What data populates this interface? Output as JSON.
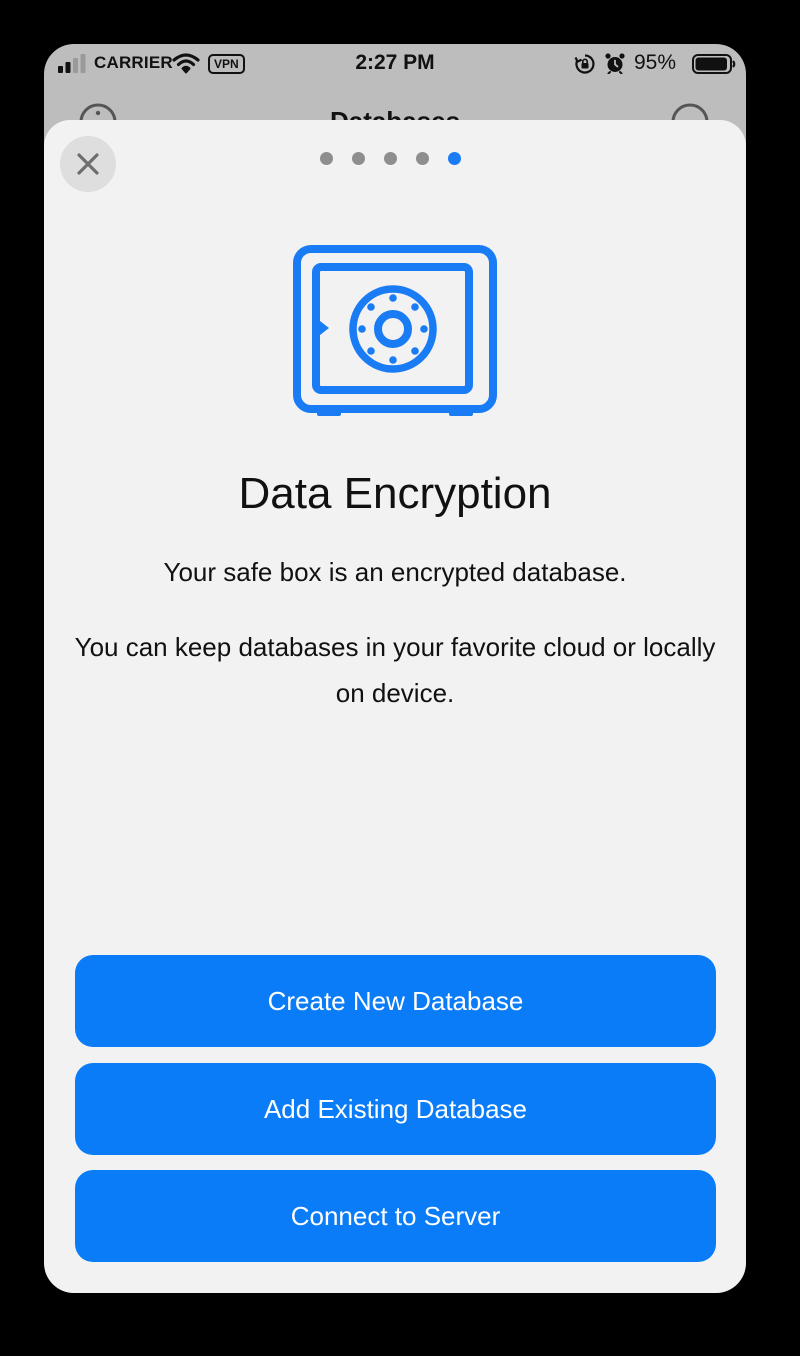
{
  "status_bar": {
    "carrier": "CARRIER",
    "vpn": "VPN",
    "time": "2:27 PM",
    "battery_percent": "95%",
    "icons": [
      "signal-icon",
      "wifi-icon",
      "rotation-lock-icon",
      "alarm-icon",
      "battery-icon"
    ]
  },
  "background_screen": {
    "title": "Databases"
  },
  "onboarding": {
    "close_icon": "close-icon",
    "page_count": 5,
    "current_page": 5,
    "illustration": "safe-box-icon",
    "heading": "Data Encryption",
    "paragraph1": "Your safe box is an encrypted database.",
    "paragraph2": "You can keep databases in your favorite cloud or locally on device."
  },
  "actions": {
    "create_new": "Create New Database",
    "add_existing": "Add Existing Database",
    "connect_server": "Connect to Server"
  },
  "colors": {
    "accent": "#0a7cf7",
    "sheet_background": "#f2f2f2",
    "dot_inactive": "#8e8e8e",
    "text": "#111111"
  }
}
